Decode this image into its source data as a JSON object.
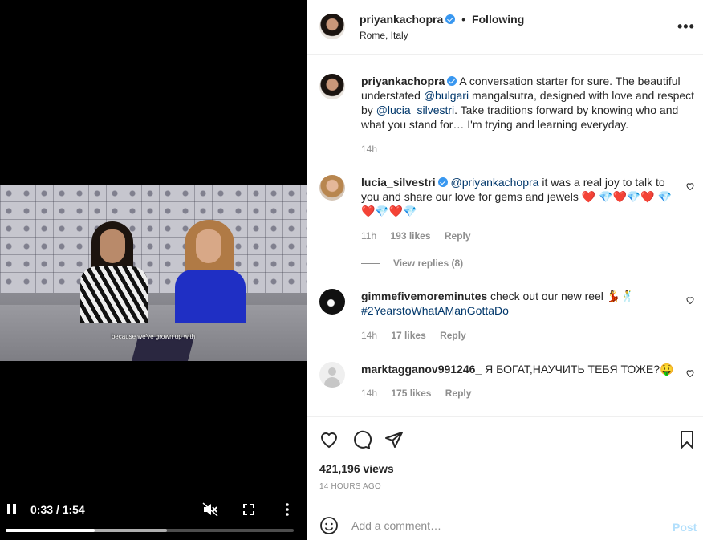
{
  "video": {
    "subtitle": "because we've grown up with",
    "time": "0:33 / 1:54",
    "progress_played": 0.31,
    "progress_buffered": 0.56
  },
  "post": {
    "username": "priyankachopra",
    "separator": "•",
    "follow_status": "Following",
    "location": "Rome, Italy",
    "more": "•••"
  },
  "caption": {
    "username": "priyankachopra",
    "text_1": "A conversation starter for sure. The beautiful understated ",
    "mention_1": "@bulgari",
    "text_2": " mangalsutra, designed with love and respect by ",
    "mention_2": "@lucia_silvestri",
    "text_3": ". Take traditions forward by knowing who and what you stand for… I'm trying and learning everyday.",
    "time": "14h"
  },
  "comments": [
    {
      "username": "lucia_silvestri",
      "mention": "@priyankachopra",
      "text": " it was a real joy to talk to you and share our love for gems and jewels ❤️ 💎❤️💎❤️ 💎❤️💎❤️💎",
      "time": "11h",
      "likes": "193 likes",
      "reply": "Reply",
      "view_replies": "View replies (8)"
    },
    {
      "username": "gimmefivemoreminutes",
      "text": " check out our new reel 💃🕺 ",
      "hashtag": "#2YearstoWhatAManGottaDo",
      "time": "14h",
      "likes": "17 likes",
      "reply": "Reply"
    },
    {
      "username": "marktagganov991246_",
      "text": " Я БОГАТ,НАУЧИТЬ ТЕБЯ ТОЖЕ?🤑",
      "time": "14h",
      "likes": "175 likes",
      "reply": "Reply"
    }
  ],
  "stats": {
    "views": "421,196 views",
    "posted": "14 HOURS AGO"
  },
  "add_comment": {
    "placeholder": "Add a comment…",
    "post_label": "Post"
  },
  "icons": {
    "like": "heart-icon",
    "comment": "comment-icon",
    "share": "share-icon",
    "save": "bookmark-icon",
    "verified_color": "#3897f0"
  }
}
